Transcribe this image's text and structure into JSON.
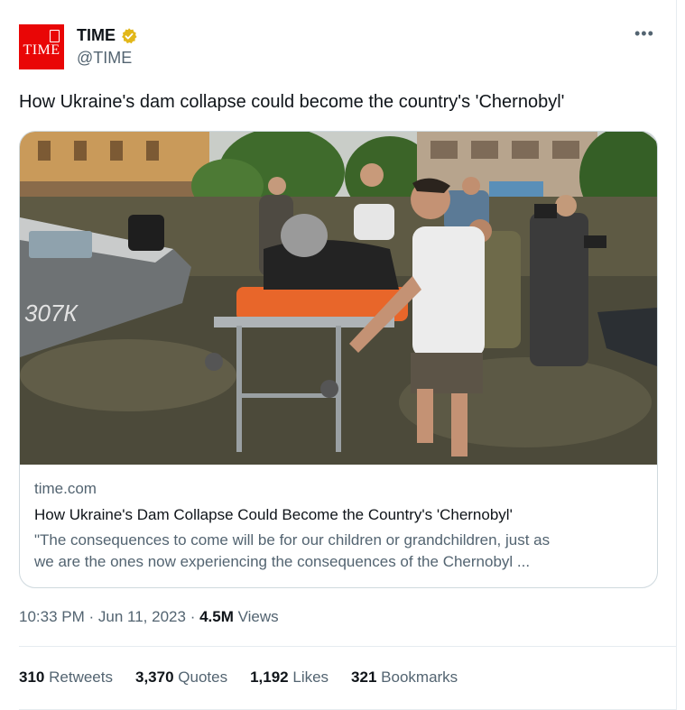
{
  "account": {
    "name": "TIME",
    "handle": "@TIME",
    "avatar_text": "TIME",
    "verified": true,
    "verified_color": "#e2b719",
    "avatar_color": "#e90606"
  },
  "more_label": "•••",
  "tweet": {
    "text": "How Ukraine's dam collapse could become the country's 'Chernobyl'"
  },
  "card": {
    "domain": "time.com",
    "title": "How Ukraine's Dam Collapse Could Become the Country's 'Chernobyl'",
    "description_line1": "\"The consequences to come will be for our children or grandchildren, just as",
    "description_line2": "we are the ones now experiencing the consequences of the Chernobyl ...",
    "boat_registration": "307К"
  },
  "meta": {
    "time": "10:33 PM",
    "date": "Jun 11, 2023",
    "separator": "·",
    "views_count": "4.5M",
    "views_label": "Views"
  },
  "stats": {
    "retweets_count": "310",
    "retweets_label": "Retweets",
    "quotes_count": "3,370",
    "quotes_label": "Quotes",
    "likes_count": "1,192",
    "likes_label": "Likes",
    "bookmarks_count": "321",
    "bookmarks_label": "Bookmarks"
  }
}
